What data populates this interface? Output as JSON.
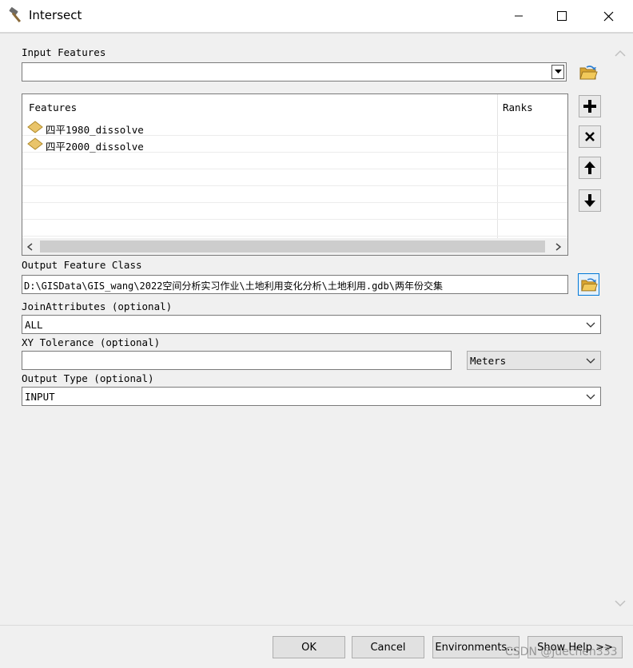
{
  "window": {
    "title": "Intersect",
    "icon": "hammer-icon",
    "controls": [
      "minimize-icon",
      "maximize-icon",
      "close-icon"
    ]
  },
  "input_features": {
    "label": "Input Features",
    "value": "",
    "columns": [
      "Features",
      "Ranks"
    ],
    "rows": [
      {
        "name": "四平1980_dissolve",
        "rank": ""
      },
      {
        "name": "四平2000_dissolve",
        "rank": ""
      }
    ],
    "side_buttons": [
      "add-icon",
      "remove-icon",
      "move-up-icon",
      "move-down-icon"
    ]
  },
  "output_feature_class": {
    "label": "Output Feature Class",
    "value": "D:\\GISData\\GIS_wang\\2022空间分析实习作业\\土地利用变化分析\\土地利用.gdb\\两年份交集"
  },
  "join_attributes": {
    "label": "JoinAttributes (optional)",
    "value": "ALL"
  },
  "xy_tolerance": {
    "label": "XY Tolerance (optional)",
    "value": "",
    "unit": "Meters"
  },
  "output_type": {
    "label": "Output Type (optional)",
    "value": "INPUT"
  },
  "buttons": {
    "ok": "OK",
    "cancel": "Cancel",
    "environments": "Environments...",
    "show_help": "Show Help >>"
  },
  "watermark": "CSDN @juechen333",
  "colors": {
    "folder": "#e8b949",
    "feature_icon": "#e9c46a",
    "highlight_border": "#0078d7"
  }
}
